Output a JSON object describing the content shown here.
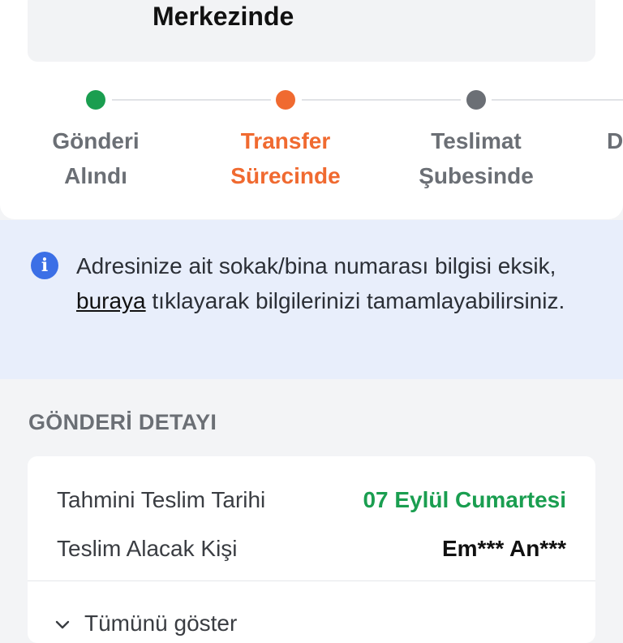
{
  "status": {
    "title": "Merkezinde"
  },
  "stepper": {
    "steps": [
      {
        "label_line1": "Gönderi",
        "label_line2": "Alındı",
        "state": "done",
        "color": "#1a9e50"
      },
      {
        "label_line1": "Transfer",
        "label_line2": "Sürecinde",
        "state": "active",
        "color": "#f06a30"
      },
      {
        "label_line1": "Teslimat",
        "label_line2": "Şubesinde",
        "state": "pending",
        "color": "#6b6f75"
      },
      {
        "label_line1": "",
        "label_line2": "D",
        "state": "pending",
        "color": "#6b6f75"
      }
    ]
  },
  "info": {
    "icon": "info-icon",
    "text_before": "Adresinize ait sokak/bina numarası bilgisi eksik, ",
    "link_text": "buraya",
    "text_after": " tıklayarak bilgilerinizi tamamlayabilirsiniz."
  },
  "details": {
    "section_title": "GÖNDERİ DETAYI",
    "rows": [
      {
        "label": "Tahmini Teslim Tarihi",
        "value": "07 Eylül Cumartesi",
        "value_color": "#1a9e50"
      },
      {
        "label": "Teslim Alacak Kişi",
        "value": "Em*** An***",
        "value_color": "#111111"
      }
    ],
    "show_all_label": "Tümünü göster",
    "show_all_icon": "chevron-down-icon"
  }
}
